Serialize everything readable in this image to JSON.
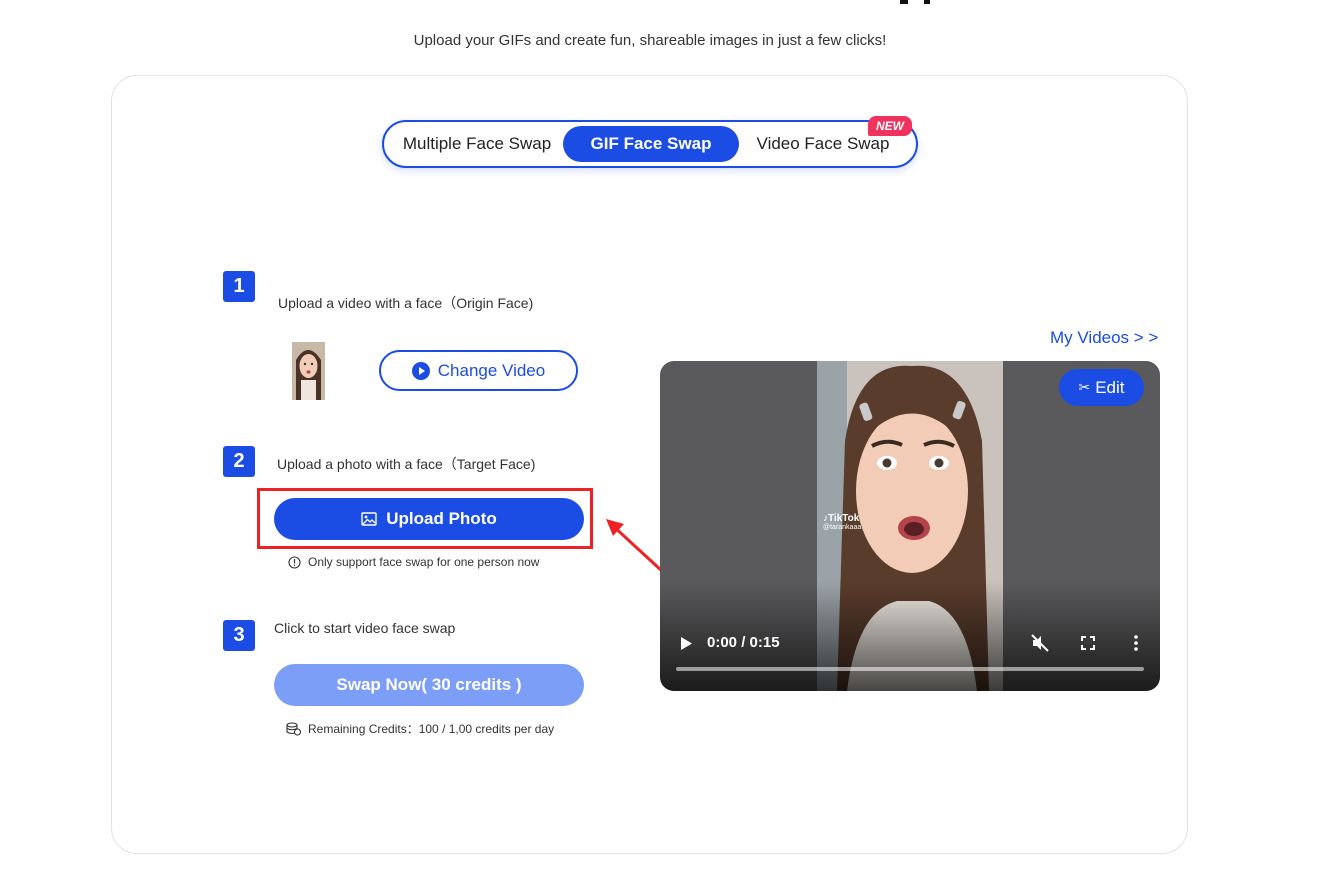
{
  "header": {
    "subtitle": "Upload your GIFs and create fun, shareable images in just a few clicks!"
  },
  "tabs": [
    {
      "label": "Multiple Face Swap",
      "active": false
    },
    {
      "label": "GIF Face Swap",
      "active": true
    },
    {
      "label": "Video Face Swap",
      "active": false,
      "badge": "NEW"
    }
  ],
  "steps": {
    "step1": {
      "number": "1",
      "label": "Upload a video with a face（Origin Face)",
      "button": "Change Video"
    },
    "step2": {
      "number": "2",
      "label": "Upload a photo with a face（Target Face)",
      "button": "Upload Photo",
      "note": "Only support face swap for one person now"
    },
    "step3": {
      "number": "3",
      "label": "Click to start video face swap",
      "button": "Swap Now( 30 credits )",
      "credits": "Remaining Credits：100 / 1,00 credits per day"
    }
  },
  "player": {
    "my_videos": "My Videos > >",
    "edit": "Edit",
    "time": "0:00 / 0:15",
    "progress": 0.0,
    "watermark": "TikTok",
    "watermark_handle": "@tarankaaa"
  },
  "colors": {
    "accent": "#1b4de4",
    "accent_light": "#7c9ef6",
    "badge": "#f0325e",
    "annotation": "#ee2222"
  }
}
